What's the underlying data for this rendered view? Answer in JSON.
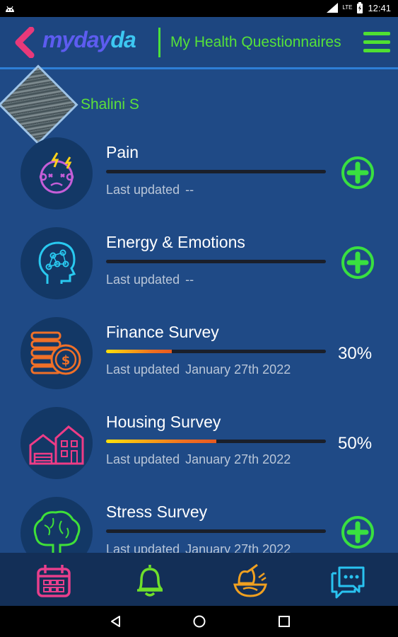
{
  "status_bar": {
    "network": "LTE",
    "time": "12:41"
  },
  "header": {
    "logo_main": "myday",
    "logo_accent": "da",
    "title": "My Health Questionnaires",
    "icons": {
      "back": "chevron-left-icon",
      "menu": "hamburger-menu-icon"
    },
    "colors": {
      "accent_green": "#56e239",
      "back_pink": "#e8397a",
      "logo_purple": "#5d5cf0",
      "logo_cyan": "#3dc7f2"
    }
  },
  "profile": {
    "name": "Shalini S"
  },
  "questionnaires": [
    {
      "title": "Pain",
      "updated_label": "Last updated",
      "updated_value": "--",
      "progress": null,
      "action": "add",
      "icon": "pain-head-icon"
    },
    {
      "title": "Energy & Emotions",
      "updated_label": "Last updated",
      "updated_value": "--",
      "progress": null,
      "action": "add",
      "icon": "brain-network-head-icon"
    },
    {
      "title": "Finance Survey",
      "updated_label": "Last updated",
      "updated_value": "January 27th 2022",
      "progress": 30,
      "progress_text": "30%",
      "icon": "coins-dollar-icon"
    },
    {
      "title": "Housing Survey",
      "updated_label": "Last updated",
      "updated_value": "January 27th 2022",
      "progress": 50,
      "progress_text": "50%",
      "icon": "houses-icon"
    },
    {
      "title": "Stress Survey",
      "updated_label": "Last updated",
      "updated_value": "January 27th 2022",
      "progress": null,
      "action": "add",
      "icon": "brain-tree-icon"
    }
  ],
  "bottom_nav": [
    {
      "icon": "calendar-icon",
      "color": "#e83f8c"
    },
    {
      "icon": "bell-icon",
      "color": "#6fe02a"
    },
    {
      "icon": "food-icon",
      "color": "#f0a020"
    },
    {
      "icon": "chat-icon",
      "color": "#29c3f0"
    }
  ],
  "system_nav": [
    "back-triangle-icon",
    "home-circle-icon",
    "recents-square-icon"
  ]
}
